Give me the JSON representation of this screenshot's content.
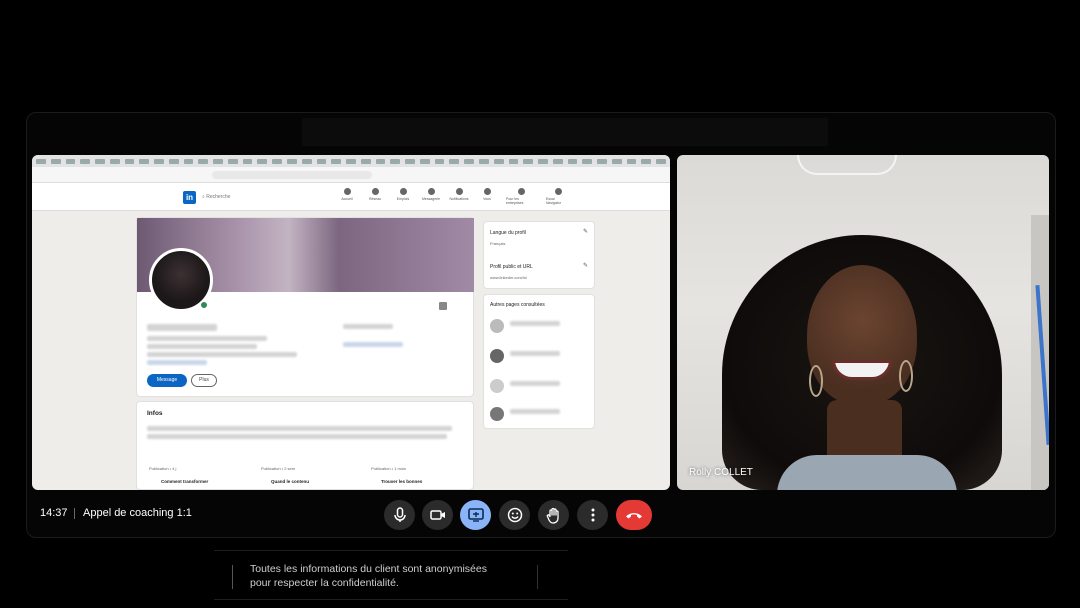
{
  "call": {
    "time": "14:37",
    "title": "Appel de coaching 1:1",
    "participant_name": "Rolly COLLET"
  },
  "linkedin": {
    "search_placeholder": "Recherche",
    "nav": [
      "Accueil",
      "Réseau",
      "Emplois",
      "Messagerie",
      "Notifications",
      "Vous",
      "Pour les entreprises",
      "Essai Navigator"
    ],
    "buttons": {
      "message": "Message",
      "more": "Plus"
    },
    "about_title": "Infos",
    "side": {
      "language_title": "Langue du profil",
      "language_value": "Français",
      "public_title": "Profil public et URL",
      "public_url": "www.linkedin.com/in/",
      "other_pages": "Autres pages consultées"
    },
    "posts": [
      {
        "meta": "Publication • 4 j",
        "title": "Comment transformer"
      },
      {
        "meta": "Publication • 2 sem",
        "title": "Quand le contenu"
      },
      {
        "meta": "Publication • 1 mois",
        "title": "Trouver les bonnes"
      }
    ]
  },
  "notice": {
    "line1": "Toutes les informations du client sont anonymisées",
    "line2": "pour respecter la confidentialité."
  },
  "controls": {
    "mic": "mic-icon",
    "camera": "camera-icon",
    "present": "present-icon",
    "reactions": "emoji-icon",
    "hand": "hand-icon",
    "more": "more-vert-icon",
    "leave": "hangup-icon",
    "colors": {
      "button": "#2b2b2b",
      "active": "#8ab4f8",
      "end": "#e53935"
    }
  }
}
